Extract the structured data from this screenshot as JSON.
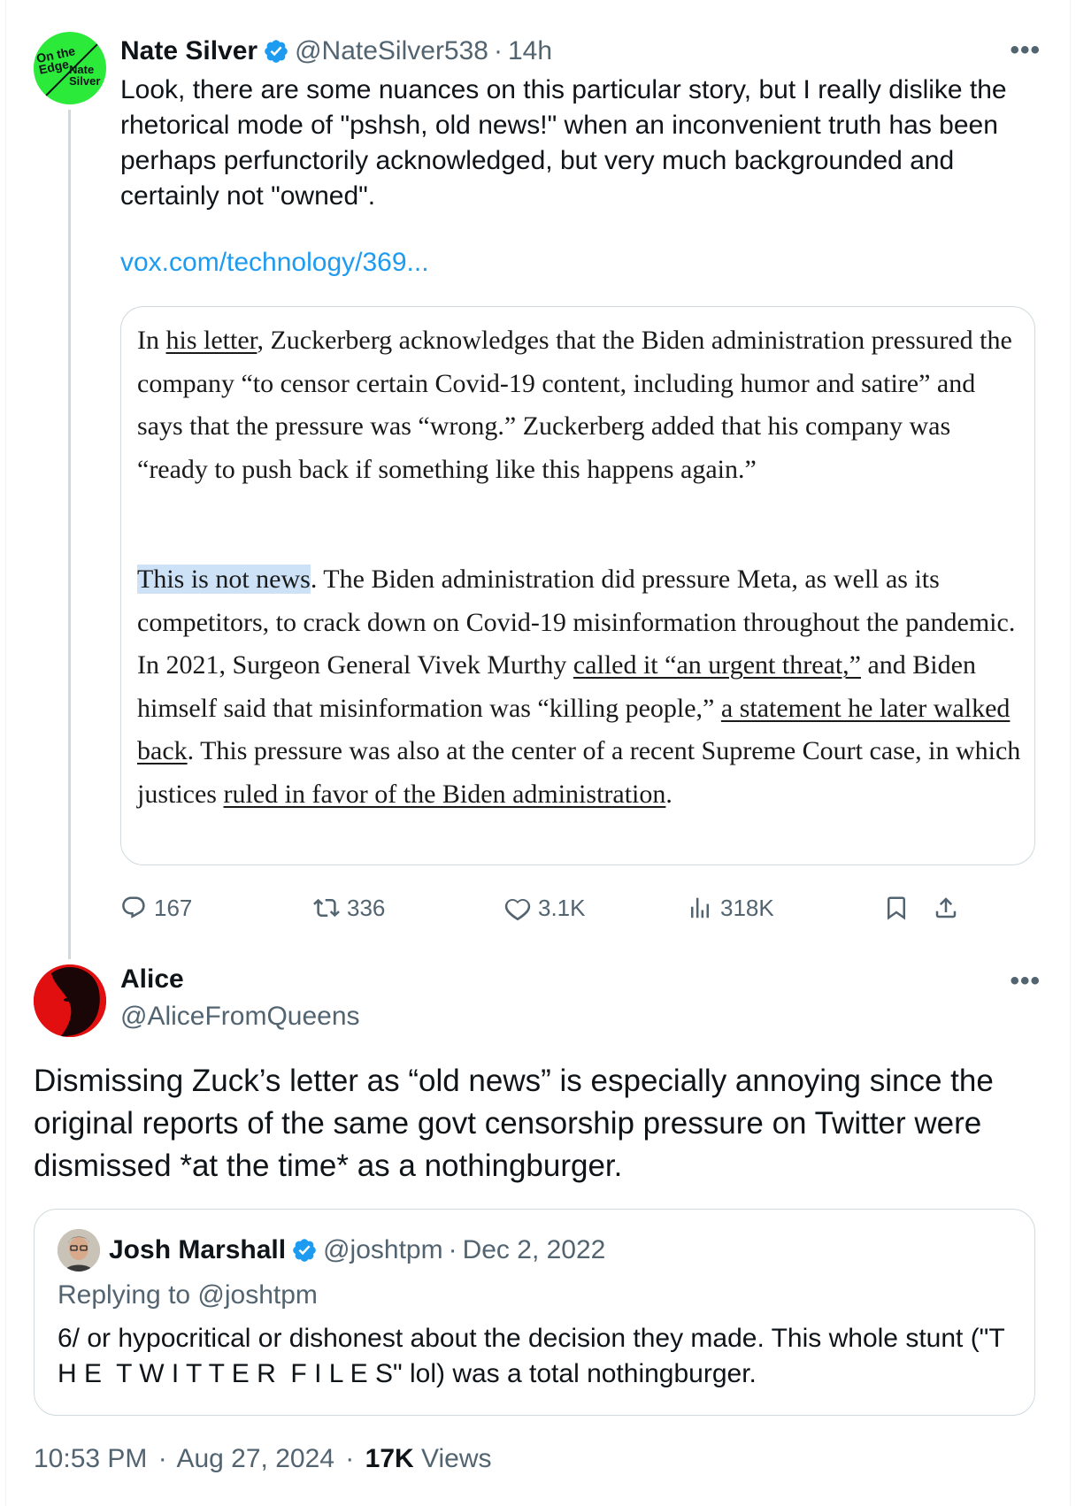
{
  "main_tweet": {
    "author_name": "Nate Silver",
    "handle": "@NateSilver538",
    "time": "14h",
    "avatar_text_1": "On the Edge",
    "avatar_text_2": "Nate Silver",
    "text": "Look, there are some nuances on this particular story, but I really dislike the rhetorical mode of \"pshsh, old news!\" when an inconvenient truth has been perhaps perfunctorily acknowledged, but very much backgrounded and certainly not \"owned\".",
    "link": "vox.com/technology/369...",
    "quote_image": {
      "p1_a": "In ",
      "p1_link": "his letter",
      "p1_b": ", Zuckerberg acknowledges that the Biden administration pressured the company “to censor certain Covid-19 content, including humor and satire” and says that the pressure was “wrong.” Zuckerberg added that his company was “ready to push back if something like this happens again.”",
      "p2_highlight": "This is not news",
      "p2_a": ". The Biden administration did pressure Meta, as well as its competitors, to crack down on Covid-19 misinformation throughout the pandemic. In 2021, Surgeon General Vivek Murthy ",
      "p2_link1": "called it “an urgent threat,”",
      "p2_b": " and Biden himself said that misinformation was “killing people,” ",
      "p2_link2": "a statement he later walked back",
      "p2_c": ". This pressure was also at the center of a recent Supreme Court case, in which justices ",
      "p2_link3": "ruled in favor of the Biden administration",
      "p2_d": "."
    },
    "stats": {
      "replies": "167",
      "retweets": "336",
      "likes": "3.1K",
      "views": "318K"
    }
  },
  "reply_tweet": {
    "author_name": "Alice",
    "handle": "@AliceFromQueens",
    "text": "Dismissing Zuck’s letter as “old news” is especially annoying since the original reports of the same govt censorship pressure on Twitter were dismissed *at the time* as a nothingburger.",
    "quoted": {
      "author_name": "Josh Marshall",
      "handle": "@joshtpm",
      "date": "Dec 2, 2022",
      "replying_to": "Replying to @joshtpm",
      "text": "6/ or hypocritical or dishonest about the decision they made. This whole stunt (\"T H E  T W I T T E R  F I L E S\" lol) was a total nothingburger."
    },
    "footer": {
      "time": "10:53 PM",
      "date": "Aug 27, 2024",
      "views_count": "17K",
      "views_label": "Views"
    }
  },
  "colors": {
    "accent": "#1d9bf0",
    "muted": "#536471",
    "border": "#cfd9de",
    "highlight": "#cde2f7",
    "nate_avatar": "#2bea3a",
    "alice_avatar": "#e10f0f"
  },
  "separators": {
    "dot": "·",
    "more": "•••"
  }
}
